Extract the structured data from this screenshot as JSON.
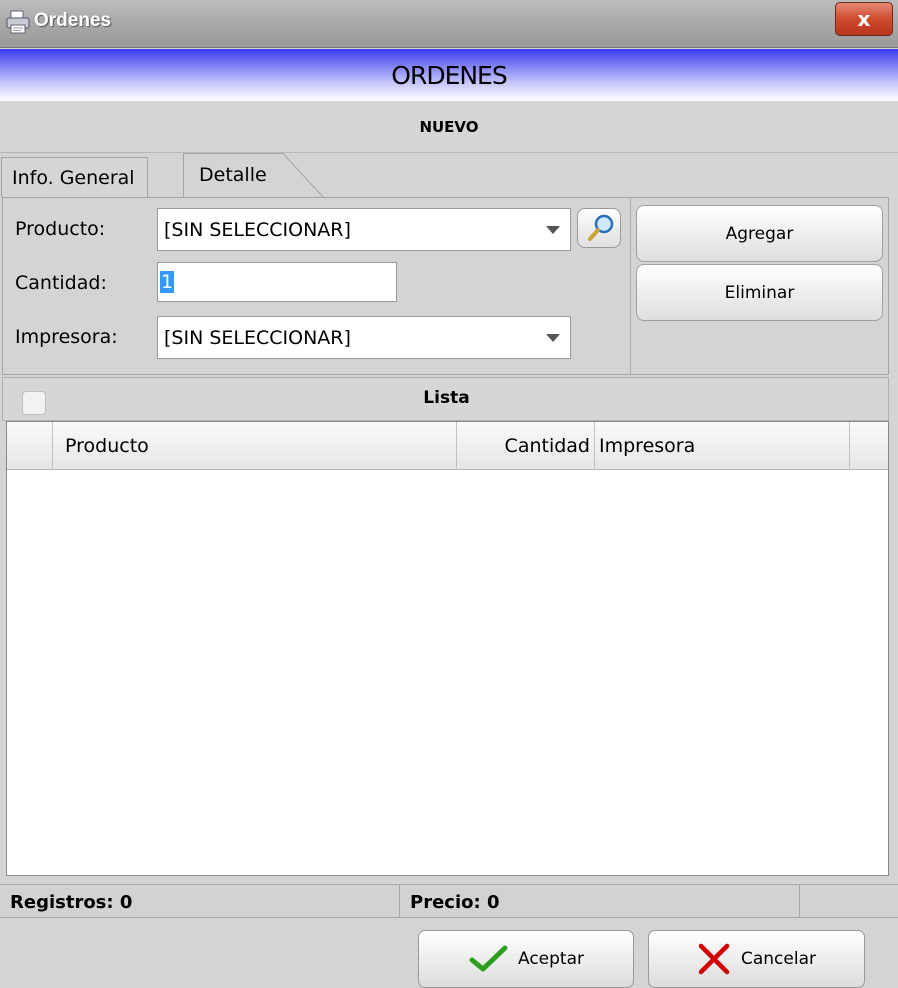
{
  "window": {
    "title": "Ordenes",
    "close_symbol": "x"
  },
  "header": {
    "title": "ORDENES",
    "subtitle": "NUEVO"
  },
  "tabs": [
    {
      "label": "Info. General",
      "active": false
    },
    {
      "label": "Detalle",
      "active": true
    }
  ],
  "form": {
    "producto": {
      "label": "Producto:",
      "value": "[SIN SELECCIONAR]"
    },
    "cantidad": {
      "label": "Cantidad:",
      "value": "1"
    },
    "impresora": {
      "label": "Impresora:",
      "value": "[SIN SELECCIONAR]"
    }
  },
  "actions": {
    "add_label": "Agregar",
    "delete_label": "Eliminar"
  },
  "list": {
    "title": "Lista",
    "columns": [
      "Producto",
      "Cantidad",
      "Impresora"
    ],
    "rows": []
  },
  "status": {
    "registros": "Registros: 0",
    "precio": "Precio: 0"
  },
  "footer": {
    "accept_label": "Aceptar",
    "cancel_label": "Cancelar"
  },
  "colors": {
    "header_gradient_top": "#3a3cf0",
    "close_button": "#cf4b2f",
    "accept_icon": "#2e9e1e",
    "cancel_icon": "#d40000"
  },
  "icons": [
    "printer-icon",
    "close-icon",
    "search-icon",
    "checkmark-icon",
    "x-icon"
  ]
}
